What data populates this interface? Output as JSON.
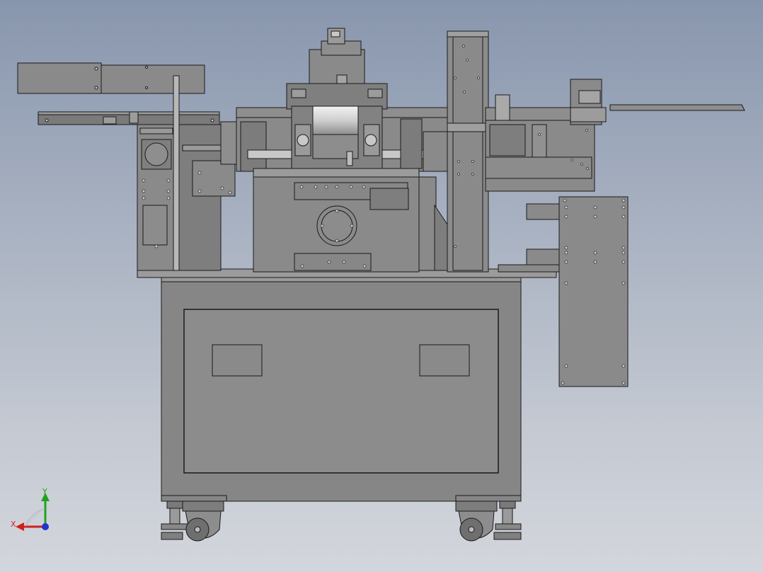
{
  "viewport": {
    "model_name": "",
    "view": "front"
  },
  "colors": {
    "background_top": "#8896ad",
    "background_bottom": "#d3d6dc",
    "body": "#8a8a8a",
    "body_dark": "#6f6f6f",
    "body_light": "#a0a0a0",
    "edge": "#1a1a1a",
    "roller_light": "#e6e6e6",
    "axis_x": "#d11f1f",
    "axis_y": "#1ea31e",
    "axis_z": "#2233cc"
  },
  "triad": {
    "x_label": "X",
    "y_label": "Y",
    "icon": "axis-triad-icon"
  }
}
